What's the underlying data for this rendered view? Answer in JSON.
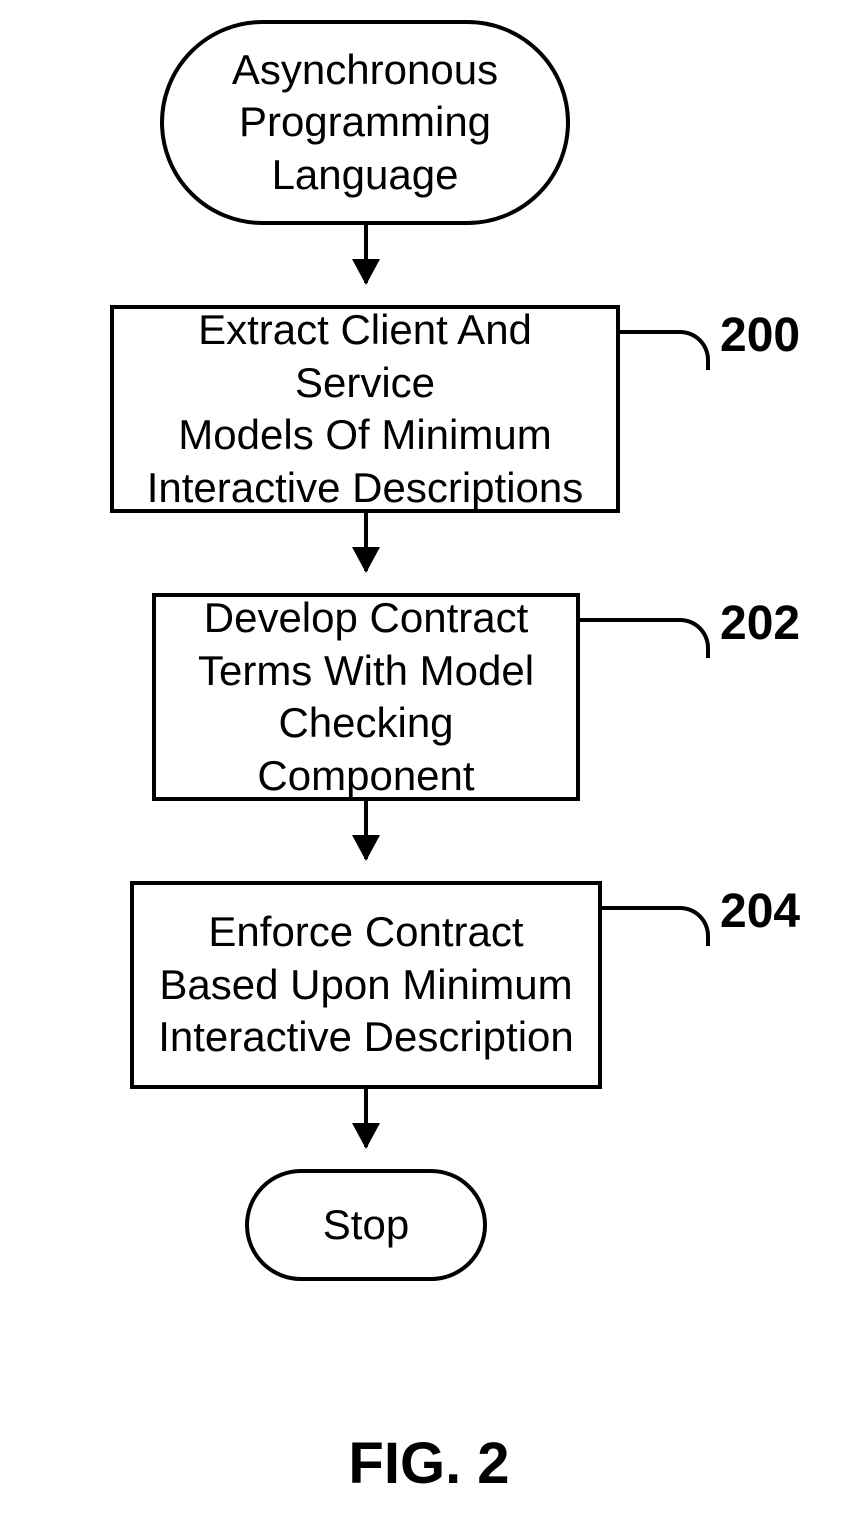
{
  "flowchart": {
    "start": {
      "text": "Asynchronous\nProgramming\nLanguage"
    },
    "steps": [
      {
        "text": "Extract Client And Service\nModels Of Minimum\nInteractive Descriptions",
        "ref": "200"
      },
      {
        "text": "Develop Contract\nTerms With Model\nChecking Component",
        "ref": "202"
      },
      {
        "text": "Enforce Contract\nBased Upon Minimum\nInteractive Description",
        "ref": "204"
      }
    ],
    "stop": {
      "text": "Stop"
    }
  },
  "caption": "FIG. 2"
}
